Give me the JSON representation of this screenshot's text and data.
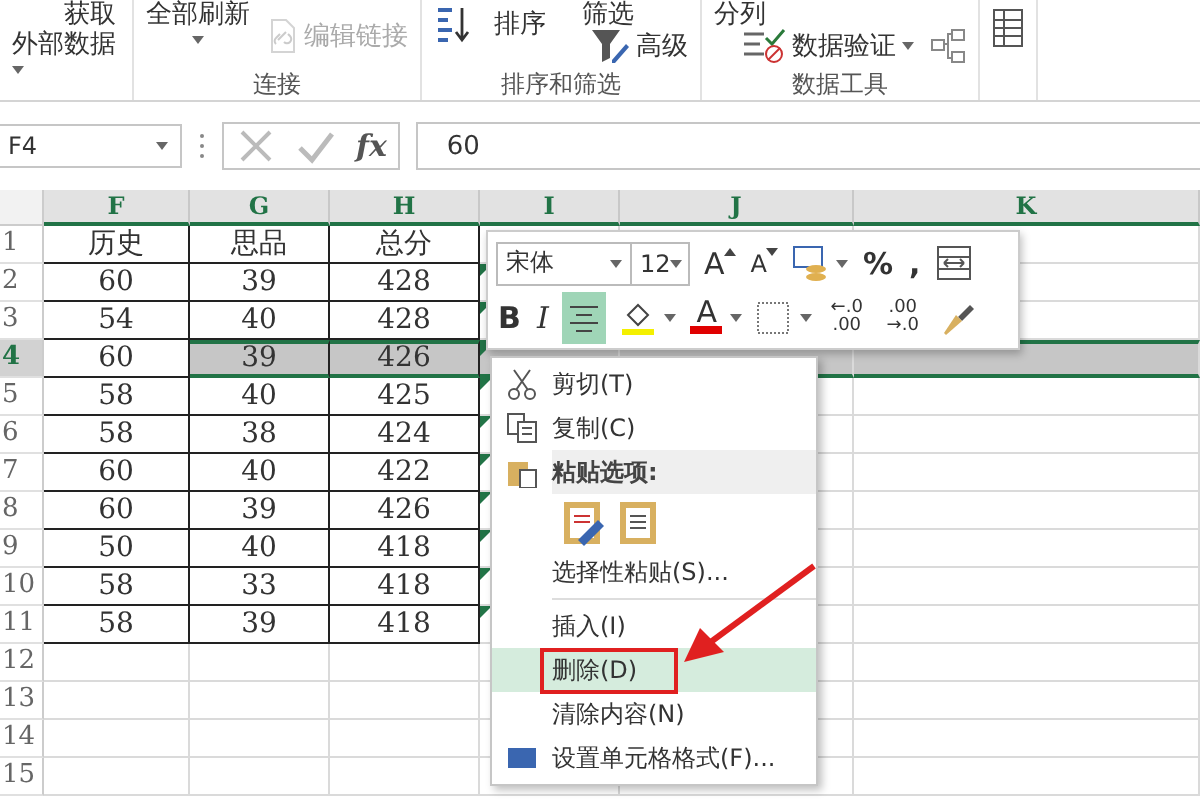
{
  "ribbon": {
    "groups": [
      {
        "buttons": [
          {
            "kind": "getdata",
            "lines": [
              "获取",
              "外部数据"
            ],
            "disabled": false,
            "dropdown": true
          }
        ]
      },
      {
        "label": "连接",
        "buttons": [
          {
            "kind": "refresh",
            "lines": [
              "全部刷新"
            ],
            "disabled": false,
            "dropdown": true
          },
          {
            "kind": "link",
            "lines": [
              "编辑链接"
            ],
            "disabled": true,
            "dropdown": false
          }
        ]
      },
      {
        "label": "排序和筛选",
        "buttons": [
          {
            "kind": "sort",
            "lines": [
              "排序"
            ],
            "disabled": false,
            "dropdown": false
          },
          {
            "kind": "filter",
            "lines": [
              "筛选"
            ],
            "disabled": false,
            "dropdown": false
          },
          {
            "kind": "advanced",
            "lines": [
              "高级"
            ],
            "disabled": false,
            "dropdown": false
          }
        ]
      },
      {
        "label": "数据工具",
        "buttons": [
          {
            "kind": "split",
            "lines": [
              "分列"
            ],
            "disabled": false,
            "dropdown": false
          },
          {
            "kind": "validate",
            "lines": [
              "数据验证"
            ],
            "disabled": false,
            "dropdown": true
          },
          {
            "kind": "relations",
            "disabled": false,
            "dropdown": false
          }
        ]
      },
      {
        "buttons": [
          {
            "kind": "outline",
            "disabled": false,
            "dropdown": false
          }
        ]
      }
    ]
  },
  "formula_bar": {
    "name_box": "F4",
    "function_button": "fx",
    "formula": "60"
  },
  "sheet": {
    "columns": [
      {
        "label": "F"
      },
      {
        "label": "G"
      },
      {
        "label": "H"
      },
      {
        "label": "I"
      },
      {
        "label": "J"
      },
      {
        "label": "K"
      }
    ],
    "rows": [
      {
        "number": "1",
        "selected": false,
        "flag": false,
        "cells": {
          "F": "历史",
          "G": "思品",
          "H": "总分"
        }
      },
      {
        "number": "2",
        "selected": false,
        "flag": true,
        "cells": {
          "F": "60",
          "G": "39",
          "H": "428"
        }
      },
      {
        "number": "3",
        "selected": false,
        "flag": true,
        "cells": {
          "F": "54",
          "G": "40",
          "H": "428"
        }
      },
      {
        "number": "4",
        "selected": true,
        "flag": true,
        "cells": {
          "F": "60",
          "G": "39",
          "H": "426"
        }
      },
      {
        "number": "5",
        "selected": false,
        "flag": true,
        "cells": {
          "F": "58",
          "G": "40",
          "H": "425"
        }
      },
      {
        "number": "6",
        "selected": false,
        "flag": true,
        "cells": {
          "F": "58",
          "G": "38",
          "H": "424"
        }
      },
      {
        "number": "7",
        "selected": false,
        "flag": true,
        "cells": {
          "F": "60",
          "G": "40",
          "H": "422"
        }
      },
      {
        "number": "8",
        "selected": false,
        "flag": true,
        "cells": {
          "F": "60",
          "G": "39",
          "H": "426"
        }
      },
      {
        "number": "9",
        "selected": false,
        "flag": true,
        "cells": {
          "F": "50",
          "G": "40",
          "H": "418"
        }
      },
      {
        "number": "10",
        "selected": false,
        "flag": true,
        "cells": {
          "F": "58",
          "G": "33",
          "H": "418"
        }
      },
      {
        "number": "11",
        "selected": false,
        "flag": true,
        "cells": {
          "F": "58",
          "G": "39",
          "H": "418"
        }
      },
      {
        "number": "12",
        "selected": false,
        "flag": false,
        "cells": {}
      },
      {
        "number": "13",
        "selected": false,
        "flag": false,
        "cells": {}
      },
      {
        "number": "14",
        "selected": false,
        "flag": false,
        "cells": {}
      },
      {
        "number": "15",
        "selected": false,
        "flag": false,
        "cells": {}
      }
    ]
  },
  "mini_toolbar": {
    "font": "宋体",
    "size": "12",
    "row_1": [
      {
        "kind": "grow",
        "label": "A",
        "selected": false
      },
      {
        "kind": "shrink",
        "label": "A",
        "selected": false
      },
      {
        "kind": "styles",
        "selected": false
      },
      {
        "kind": "text",
        "label": "%",
        "selected": false
      },
      {
        "kind": "text",
        "label": ",",
        "selected": false
      },
      {
        "kind": "wrap",
        "selected": false
      }
    ],
    "row_2": [
      {
        "kind": "text",
        "label": "B",
        "selected": false
      },
      {
        "kind": "italic",
        "label": "I",
        "selected": false
      },
      {
        "kind": "center",
        "selected": true
      },
      {
        "kind": "fill",
        "selected": false
      },
      {
        "kind": "fontcolor",
        "label": "A",
        "selected": false
      },
      {
        "kind": "border",
        "selected": false
      },
      {
        "kind": "decimal",
        "label": "←.0 .00",
        "selected": false
      },
      {
        "kind": "decimal",
        "label": ".00 →.0",
        "selected": false
      },
      {
        "kind": "painter",
        "selected": false
      }
    ]
  },
  "context_menu": {
    "items": [
      {
        "kind": "cut",
        "text": "剪切(T)",
        "selected": false,
        "highlighted": false
      },
      {
        "kind": "copy",
        "text": "复制(C)",
        "selected": false,
        "highlighted": false
      },
      {
        "kind": "header",
        "text": "粘贴选项:",
        "selected": false,
        "highlighted": false
      },
      {
        "kind": "pasteicons"
      },
      {
        "kind": "item",
        "text": "选择性粘贴(S)...",
        "selected": false,
        "highlighted": false
      },
      {
        "kind": "separator"
      },
      {
        "kind": "item",
        "text": "插入(I)",
        "selected": false,
        "highlighted": false
      },
      {
        "kind": "item",
        "text": "删除(D)",
        "selected": true,
        "highlighted": true
      },
      {
        "kind": "item",
        "text": "清除内容(N)",
        "selected": false,
        "highlighted": false
      },
      {
        "kind": "format",
        "text": "设置单元格格式(F)...",
        "selected": false,
        "highlighted": false
      }
    ]
  },
  "callout_arrow": true
}
